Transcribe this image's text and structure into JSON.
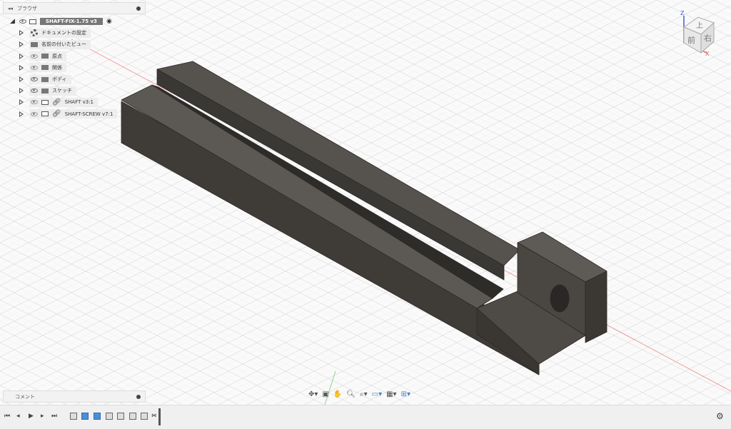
{
  "browser": {
    "title": "ブラウザ",
    "root": "SHAFT-FIX-1.75 v3",
    "items": [
      {
        "label": "ドキュメントの設定",
        "icon": "gear-icon"
      },
      {
        "label": "名前の付いたビュー",
        "icon": "folder-icon"
      },
      {
        "label": "原点",
        "icon": "folder-icon"
      },
      {
        "label": "関係",
        "icon": "folder-icon"
      },
      {
        "label": "ボディ",
        "icon": "folder-icon"
      },
      {
        "label": "スケッチ",
        "icon": "folder-icon"
      },
      {
        "label": "SHAFT v3:1",
        "icon": "component-link-icon"
      },
      {
        "label": "SHAFT-SCREW v7:1",
        "icon": "component-link-icon"
      }
    ]
  },
  "comments": {
    "title": "コメント"
  },
  "viewcube": {
    "top": "上",
    "front": "前",
    "right": "右",
    "z": "Z",
    "x": "X"
  },
  "colors": {
    "model": "#4b4843",
    "axis_x": "#e06060",
    "axis_y": "#60c060",
    "axis_z": "#4060d0"
  }
}
